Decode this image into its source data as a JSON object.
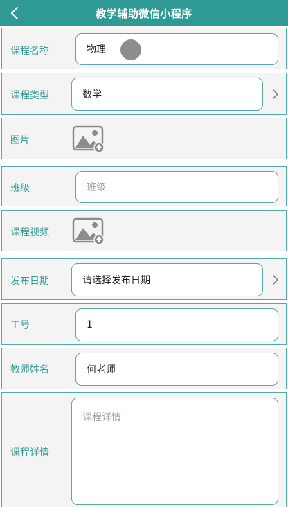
{
  "header": {
    "title": "教学辅助微信小程序",
    "back_icon": "chevron-left-icon",
    "background": "#2e9a93"
  },
  "form": {
    "course_name": {
      "label": "课程名称",
      "value": "物理"
    },
    "course_type": {
      "label": "课程类型",
      "value": "数学"
    },
    "image": {
      "label": "图片",
      "icon": "image-upload-icon"
    },
    "class": {
      "label": "班级",
      "placeholder": "班级"
    },
    "course_video": {
      "label": "课程视频",
      "icon": "image-upload-icon"
    },
    "publish_date": {
      "label": "发布日期",
      "value": "请选择发布日期"
    },
    "job_number": {
      "label": "工号",
      "value": "1"
    },
    "teacher_name": {
      "label": "教师姓名",
      "value": "何老师"
    },
    "course_detail": {
      "label": "课程详情",
      "placeholder": "课程详情"
    }
  },
  "colors": {
    "accent": "#2e9a93",
    "label": "#3a9a94",
    "border": "#54aaa5",
    "row_bg": "#f4f4f4"
  }
}
